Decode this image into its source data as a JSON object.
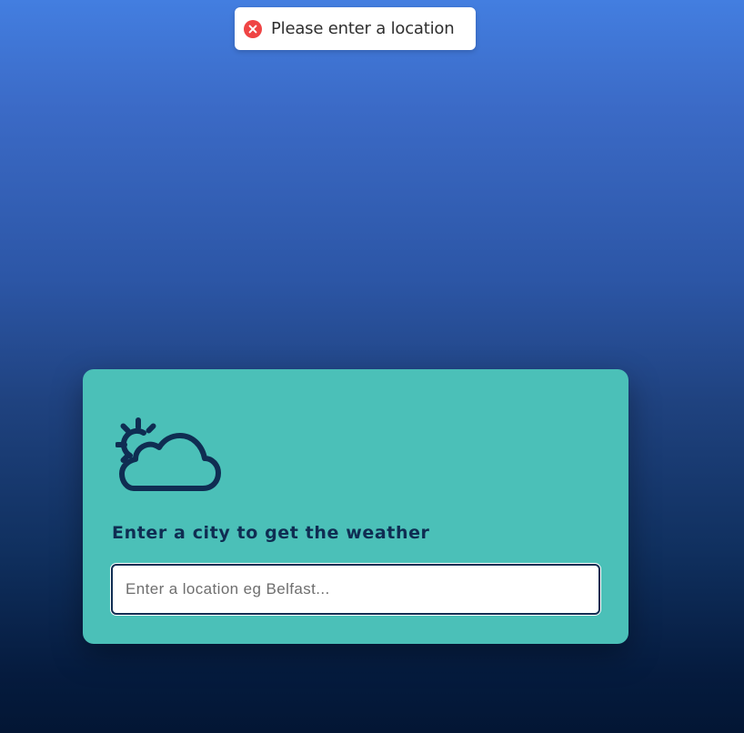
{
  "toast": {
    "icon": "error-circle-x-icon",
    "message": "Please enter a location",
    "status_color": "#ef4444"
  },
  "card": {
    "icon": "sun-behind-cloud-icon",
    "heading": "Enter a city to get the weather",
    "search": {
      "value": "",
      "placeholder": "Enter a location eg Belfast..."
    },
    "background_color": "#4bc0b8",
    "accent_color": "#0f2d52"
  }
}
